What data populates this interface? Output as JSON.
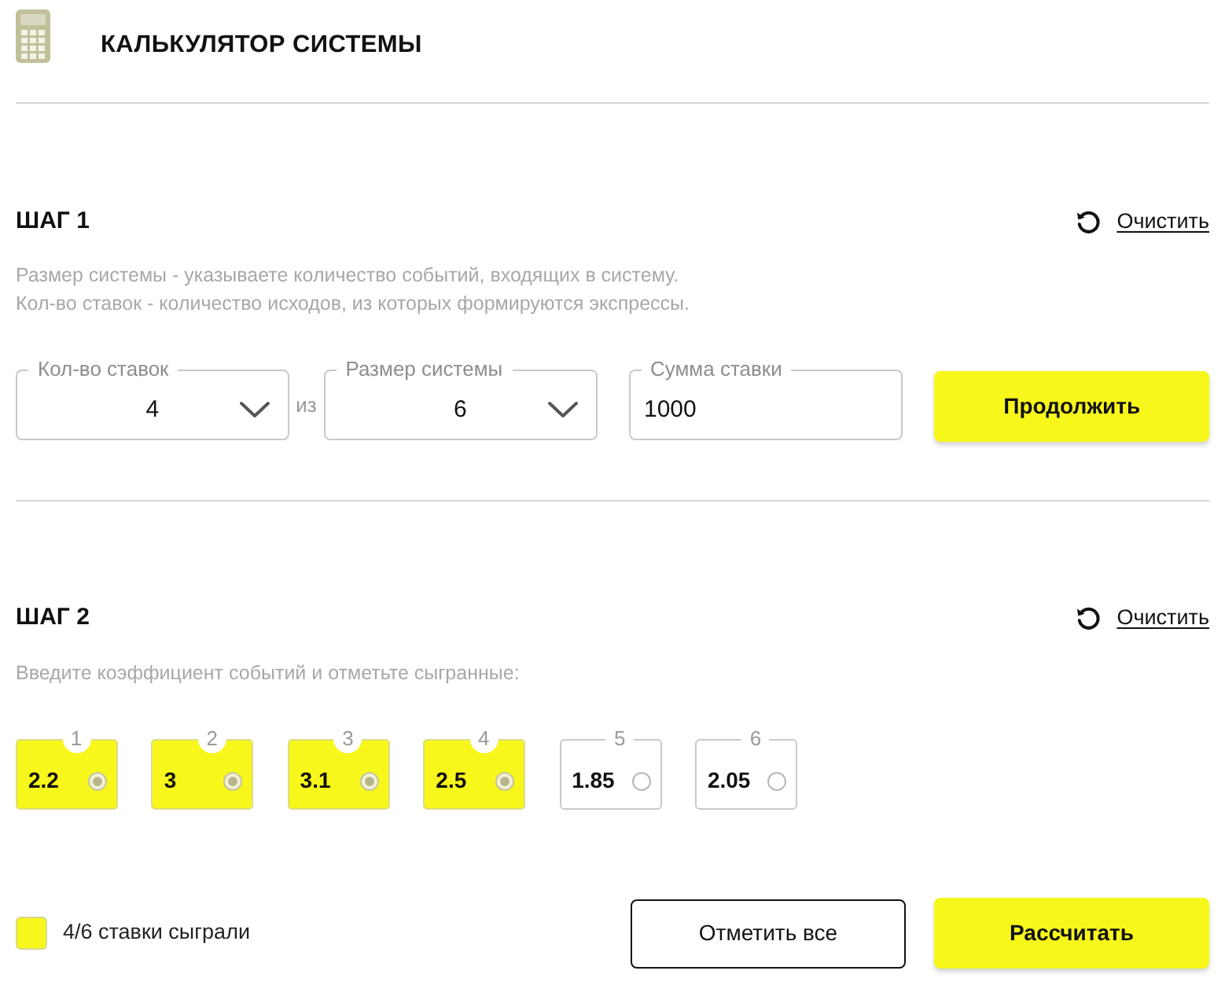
{
  "header": {
    "title": "КАЛЬКУЛЯТОР СИСТЕМЫ"
  },
  "step1": {
    "title": "ШАГ 1",
    "clear_link": "Очистить",
    "description": [
      "Размер системы - указываете количество событий, входящих в систему.",
      "Кол-во ставок - количество исходов, из которых формируются экспрессы."
    ],
    "fields": [
      {
        "kind": "select",
        "label": "Кол-во ставок",
        "value": "4"
      },
      {
        "kind": "separator",
        "text": "из"
      },
      {
        "kind": "select",
        "label": "Размер системы",
        "value": "6"
      },
      {
        "kind": "input",
        "label": "Сумма ставки",
        "value": "1000"
      }
    ],
    "continue_button": "Продолжить"
  },
  "step2": {
    "title": "ШАГ 2",
    "clear_link": "Очистить",
    "description": "Введите коэффициент событий и отметьте сыгранные:",
    "events": [
      {
        "number": "1",
        "odds": "2.2",
        "checked": true
      },
      {
        "number": "2",
        "odds": "3",
        "checked": true
      },
      {
        "number": "3",
        "odds": "3.1",
        "checked": true
      },
      {
        "number": "4",
        "odds": "2.5",
        "checked": true
      },
      {
        "number": "5",
        "odds": "1.85",
        "checked": false
      },
      {
        "number": "6",
        "odds": "2.05",
        "checked": false
      }
    ],
    "played": {
      "checked": true,
      "label": "4/6 ставки сыграли"
    },
    "mark_all_button": "Отметить все",
    "calculate_button": "Рассчитать"
  }
}
